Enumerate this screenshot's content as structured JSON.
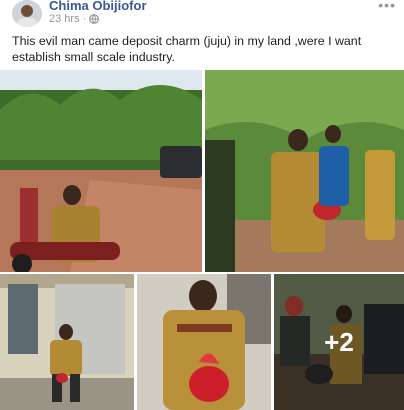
{
  "post": {
    "author": "Chima Obijiofor",
    "timestamp": "23 hrs",
    "privacy_icon": "globe-icon",
    "more_icon": "more-options-icon",
    "caption": "This evil man came deposit charm (juju) in my land ,were I want establish small scale industry."
  },
  "gallery": {
    "more_photos_label": "+2"
  },
  "colors": {
    "author_link": "#365899",
    "meta_text": "#90949c"
  }
}
